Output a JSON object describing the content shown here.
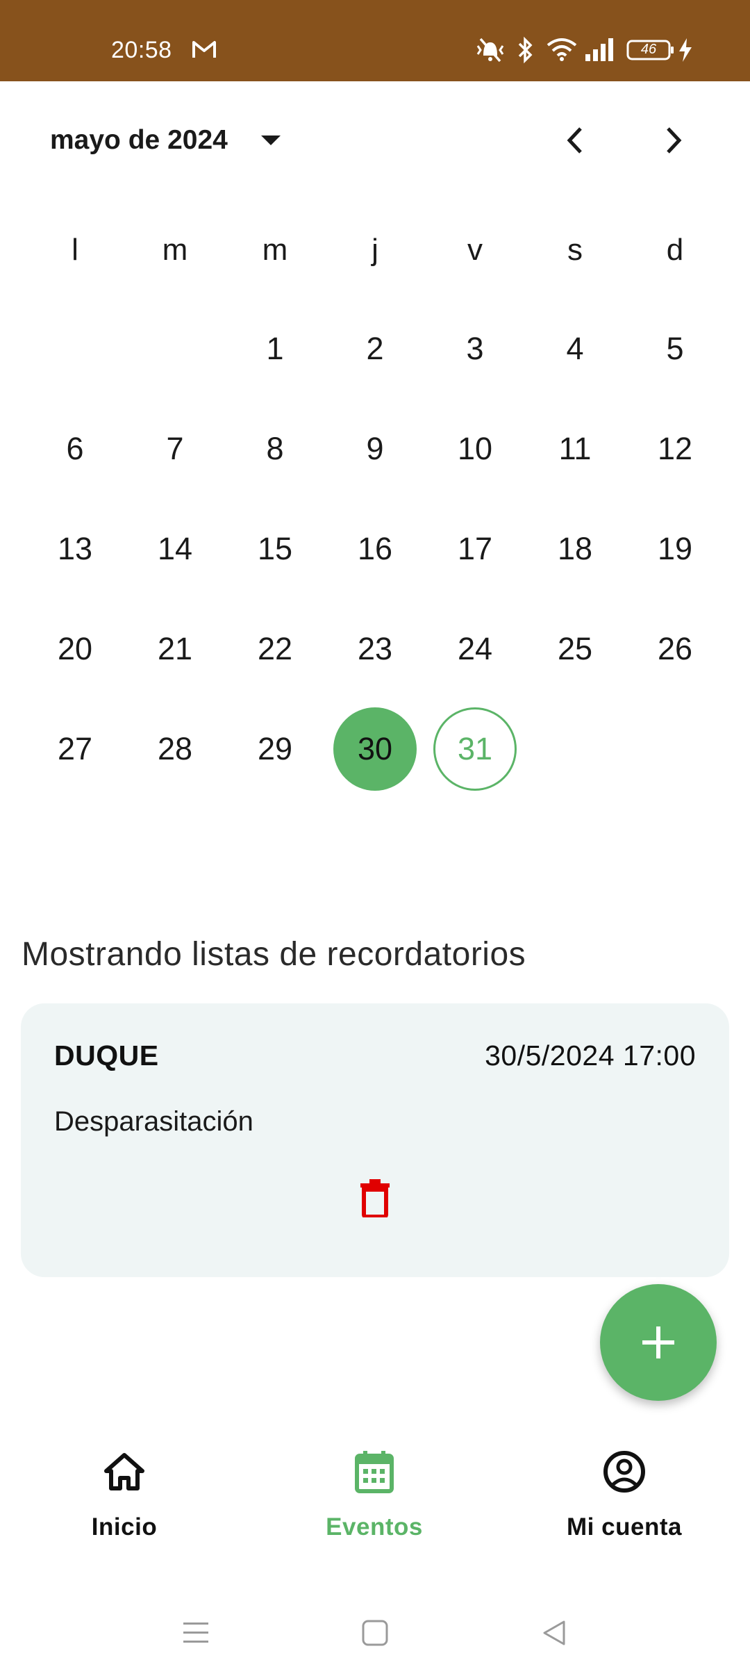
{
  "status_bar": {
    "time": "20:58",
    "battery": "46",
    "color": "#87521c",
    "icons": [
      "gmail-icon",
      "mute-vibrate-icon",
      "bluetooth-icon",
      "wifi-icon",
      "signal-icon",
      "battery-icon",
      "charging-icon"
    ]
  },
  "calendar": {
    "month_label": "mayo de 2024",
    "weekdays": [
      "l",
      "m",
      "m",
      "j",
      "v",
      "s",
      "d"
    ],
    "weeks": [
      [
        "",
        "",
        "1",
        "2",
        "3",
        "4",
        "5"
      ],
      [
        "6",
        "7",
        "8",
        "9",
        "10",
        "11",
        "12"
      ],
      [
        "13",
        "14",
        "15",
        "16",
        "17",
        "18",
        "19"
      ],
      [
        "20",
        "21",
        "22",
        "23",
        "24",
        "25",
        "26"
      ],
      [
        "27",
        "28",
        "29",
        "30",
        "31",
        "",
        ""
      ]
    ],
    "selected_day": "30",
    "today": "31",
    "accent_color": "#5bb467"
  },
  "reminders": {
    "section_title": "Mostrando listas de recordatorios",
    "items": [
      {
        "pet": "DUQUE",
        "datetime": "30/5/2024 17:00",
        "description": "Desparasitación",
        "delete_icon": "trash-icon",
        "delete_color": "#e00000"
      }
    ]
  },
  "fab": {
    "icon": "plus-icon"
  },
  "bottom_nav": {
    "items": [
      {
        "label": "Inicio",
        "icon": "home-icon",
        "active": false
      },
      {
        "label": "Eventos",
        "icon": "calendar-icon",
        "active": true
      },
      {
        "label": "Mi cuenta",
        "icon": "account-circle-icon",
        "active": false
      }
    ]
  },
  "system_nav": {
    "icons": [
      "menu-icon",
      "home-square-icon",
      "back-icon"
    ]
  }
}
